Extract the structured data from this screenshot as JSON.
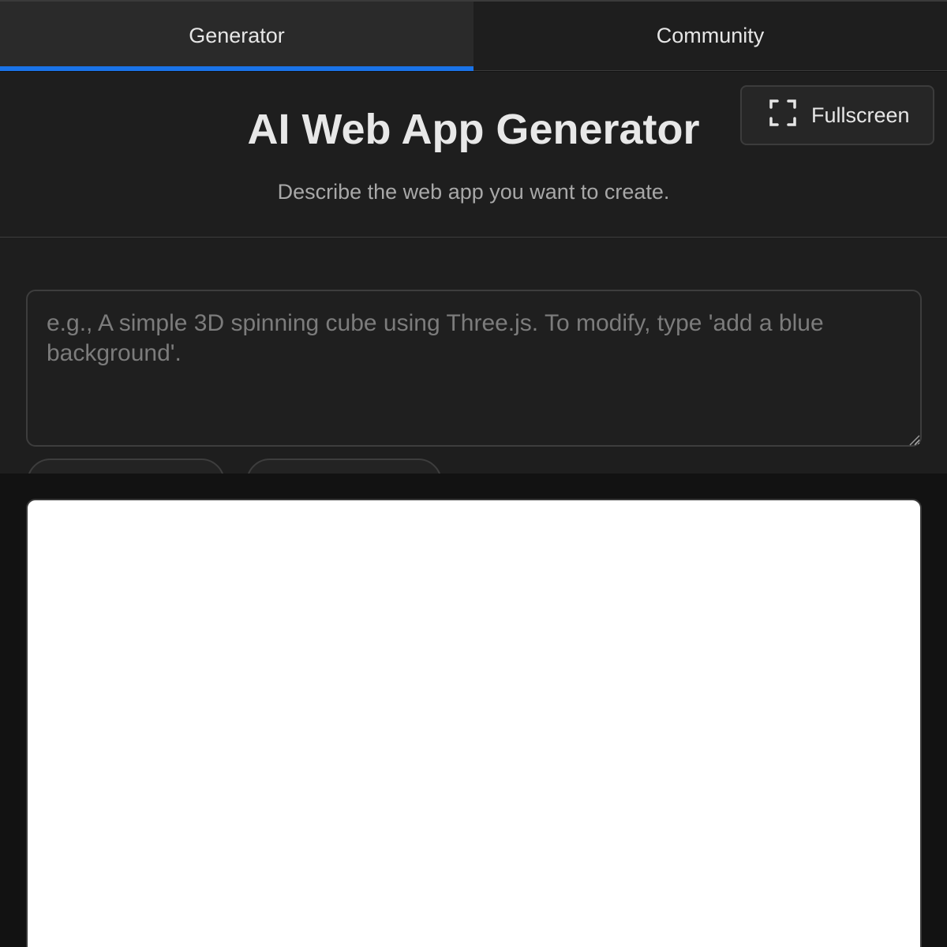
{
  "tabs": [
    {
      "label": "Generator",
      "active": true
    },
    {
      "label": "Community",
      "active": false
    }
  ],
  "header": {
    "title": "AI Web App Generator",
    "subtitle": "Describe the web app you want to create.",
    "fullscreen_label": "Fullscreen",
    "fullscreen_icon": "fullscreen-corners-icon"
  },
  "prompt": {
    "value": "",
    "placeholder": "e.g., A simple 3D spinning cube using Three.js. To modify, type 'add a blue background'."
  },
  "colors": {
    "accent": "#1a73e8",
    "panel_bg": "#1e1e1e",
    "page_bg": "#121212",
    "preview_bg": "#ffffff"
  }
}
